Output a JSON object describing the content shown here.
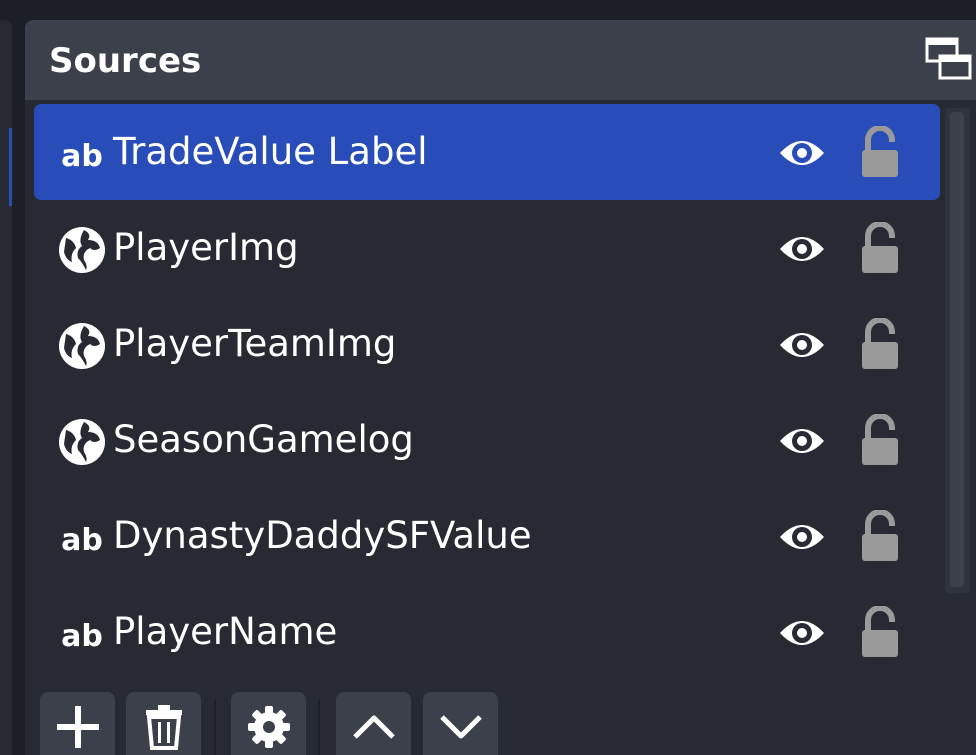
{
  "dock": {
    "title": "Sources",
    "undock_icon": "float-windows-icon"
  },
  "sources": [
    {
      "name": "TradeValue Label",
      "type": "text",
      "icon": "text-ab-icon",
      "visible": true,
      "locked": false,
      "selected": true
    },
    {
      "name": "PlayerImg",
      "type": "browser",
      "icon": "globe-icon",
      "visible": true,
      "locked": false,
      "selected": false
    },
    {
      "name": "PlayerTeamImg",
      "type": "browser",
      "icon": "globe-icon",
      "visible": true,
      "locked": false,
      "selected": false
    },
    {
      "name": "SeasonGamelog",
      "type": "browser",
      "icon": "globe-icon",
      "visible": true,
      "locked": false,
      "selected": false
    },
    {
      "name": "DynastyDaddySFValue",
      "type": "text",
      "icon": "text-ab-icon",
      "visible": true,
      "locked": false,
      "selected": false
    },
    {
      "name": "PlayerName",
      "type": "text",
      "icon": "text-ab-icon",
      "visible": true,
      "locked": false,
      "selected": false
    }
  ],
  "toolbar": {
    "buttons": [
      "plus-icon",
      "trash-icon",
      "gear-icon",
      "chevron-up-icon",
      "chevron-down-icon"
    ]
  },
  "colors": {
    "selected_row": "#284cb8",
    "panel": "#272a33",
    "header": "#3c404b",
    "lock": "#9a9a9a"
  }
}
